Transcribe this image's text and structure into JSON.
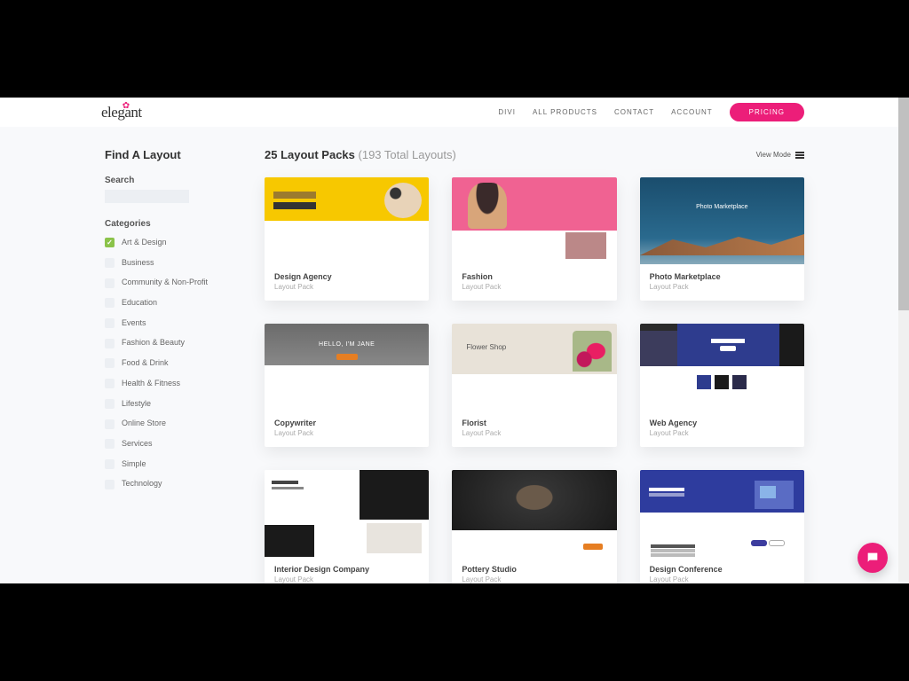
{
  "brand": {
    "name": "elegant"
  },
  "nav": {
    "items": [
      "DIVI",
      "ALL PRODUCTS",
      "CONTACT",
      "ACCOUNT"
    ],
    "pricing": "PRICING"
  },
  "sidebar": {
    "title": "Find A Layout",
    "search_label": "Search",
    "categories_label": "Categories",
    "categories": [
      {
        "label": "Art & Design",
        "checked": true
      },
      {
        "label": "Business",
        "checked": false
      },
      {
        "label": "Community & Non-Profit",
        "checked": false
      },
      {
        "label": "Education",
        "checked": false
      },
      {
        "label": "Events",
        "checked": false
      },
      {
        "label": "Fashion & Beauty",
        "checked": false
      },
      {
        "label": "Food & Drink",
        "checked": false
      },
      {
        "label": "Health & Fitness",
        "checked": false
      },
      {
        "label": "Lifestyle",
        "checked": false
      },
      {
        "label": "Online Store",
        "checked": false
      },
      {
        "label": "Services",
        "checked": false
      },
      {
        "label": "Simple",
        "checked": false
      },
      {
        "label": "Technology",
        "checked": false
      }
    ]
  },
  "main": {
    "title_count": "25 Layout Packs",
    "title_sub": "(193 Total Layouts)",
    "view_mode": "View Mode",
    "pack_subtitle": "Layout Pack",
    "packs": [
      {
        "title": "Design Agency"
      },
      {
        "title": "Fashion"
      },
      {
        "title": "Photo Marketplace"
      },
      {
        "title": "Copywriter"
      },
      {
        "title": "Florist"
      },
      {
        "title": "Web Agency"
      },
      {
        "title": "Interior Design Company"
      },
      {
        "title": "Pottery Studio"
      },
      {
        "title": "Design Conference"
      }
    ]
  }
}
